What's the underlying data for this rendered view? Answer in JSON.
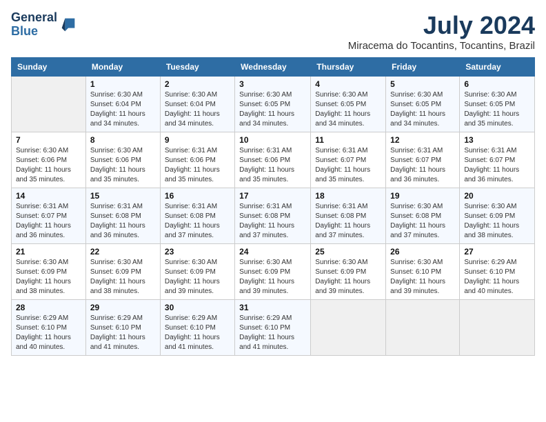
{
  "header": {
    "logo_line1": "General",
    "logo_line2": "Blue",
    "main_title": "July 2024",
    "subtitle": "Miracema do Tocantins, Tocantins, Brazil"
  },
  "calendar": {
    "days_of_week": [
      "Sunday",
      "Monday",
      "Tuesday",
      "Wednesday",
      "Thursday",
      "Friday",
      "Saturday"
    ],
    "weeks": [
      [
        {
          "day": "",
          "info": ""
        },
        {
          "day": "1",
          "info": "Sunrise: 6:30 AM\nSunset: 6:04 PM\nDaylight: 11 hours\nand 34 minutes."
        },
        {
          "day": "2",
          "info": "Sunrise: 6:30 AM\nSunset: 6:04 PM\nDaylight: 11 hours\nand 34 minutes."
        },
        {
          "day": "3",
          "info": "Sunrise: 6:30 AM\nSunset: 6:05 PM\nDaylight: 11 hours\nand 34 minutes."
        },
        {
          "day": "4",
          "info": "Sunrise: 6:30 AM\nSunset: 6:05 PM\nDaylight: 11 hours\nand 34 minutes."
        },
        {
          "day": "5",
          "info": "Sunrise: 6:30 AM\nSunset: 6:05 PM\nDaylight: 11 hours\nand 34 minutes."
        },
        {
          "day": "6",
          "info": "Sunrise: 6:30 AM\nSunset: 6:05 PM\nDaylight: 11 hours\nand 35 minutes."
        }
      ],
      [
        {
          "day": "7",
          "info": "Sunrise: 6:30 AM\nSunset: 6:06 PM\nDaylight: 11 hours\nand 35 minutes."
        },
        {
          "day": "8",
          "info": "Sunrise: 6:30 AM\nSunset: 6:06 PM\nDaylight: 11 hours\nand 35 minutes."
        },
        {
          "day": "9",
          "info": "Sunrise: 6:31 AM\nSunset: 6:06 PM\nDaylight: 11 hours\nand 35 minutes."
        },
        {
          "day": "10",
          "info": "Sunrise: 6:31 AM\nSunset: 6:06 PM\nDaylight: 11 hours\nand 35 minutes."
        },
        {
          "day": "11",
          "info": "Sunrise: 6:31 AM\nSunset: 6:07 PM\nDaylight: 11 hours\nand 35 minutes."
        },
        {
          "day": "12",
          "info": "Sunrise: 6:31 AM\nSunset: 6:07 PM\nDaylight: 11 hours\nand 36 minutes."
        },
        {
          "day": "13",
          "info": "Sunrise: 6:31 AM\nSunset: 6:07 PM\nDaylight: 11 hours\nand 36 minutes."
        }
      ],
      [
        {
          "day": "14",
          "info": "Sunrise: 6:31 AM\nSunset: 6:07 PM\nDaylight: 11 hours\nand 36 minutes."
        },
        {
          "day": "15",
          "info": "Sunrise: 6:31 AM\nSunset: 6:08 PM\nDaylight: 11 hours\nand 36 minutes."
        },
        {
          "day": "16",
          "info": "Sunrise: 6:31 AM\nSunset: 6:08 PM\nDaylight: 11 hours\nand 37 minutes."
        },
        {
          "day": "17",
          "info": "Sunrise: 6:31 AM\nSunset: 6:08 PM\nDaylight: 11 hours\nand 37 minutes."
        },
        {
          "day": "18",
          "info": "Sunrise: 6:31 AM\nSunset: 6:08 PM\nDaylight: 11 hours\nand 37 minutes."
        },
        {
          "day": "19",
          "info": "Sunrise: 6:30 AM\nSunset: 6:08 PM\nDaylight: 11 hours\nand 37 minutes."
        },
        {
          "day": "20",
          "info": "Sunrise: 6:30 AM\nSunset: 6:09 PM\nDaylight: 11 hours\nand 38 minutes."
        }
      ],
      [
        {
          "day": "21",
          "info": "Sunrise: 6:30 AM\nSunset: 6:09 PM\nDaylight: 11 hours\nand 38 minutes."
        },
        {
          "day": "22",
          "info": "Sunrise: 6:30 AM\nSunset: 6:09 PM\nDaylight: 11 hours\nand 38 minutes."
        },
        {
          "day": "23",
          "info": "Sunrise: 6:30 AM\nSunset: 6:09 PM\nDaylight: 11 hours\nand 39 minutes."
        },
        {
          "day": "24",
          "info": "Sunrise: 6:30 AM\nSunset: 6:09 PM\nDaylight: 11 hours\nand 39 minutes."
        },
        {
          "day": "25",
          "info": "Sunrise: 6:30 AM\nSunset: 6:09 PM\nDaylight: 11 hours\nand 39 minutes."
        },
        {
          "day": "26",
          "info": "Sunrise: 6:30 AM\nSunset: 6:10 PM\nDaylight: 11 hours\nand 39 minutes."
        },
        {
          "day": "27",
          "info": "Sunrise: 6:29 AM\nSunset: 6:10 PM\nDaylight: 11 hours\nand 40 minutes."
        }
      ],
      [
        {
          "day": "28",
          "info": "Sunrise: 6:29 AM\nSunset: 6:10 PM\nDaylight: 11 hours\nand 40 minutes."
        },
        {
          "day": "29",
          "info": "Sunrise: 6:29 AM\nSunset: 6:10 PM\nDaylight: 11 hours\nand 41 minutes."
        },
        {
          "day": "30",
          "info": "Sunrise: 6:29 AM\nSunset: 6:10 PM\nDaylight: 11 hours\nand 41 minutes."
        },
        {
          "day": "31",
          "info": "Sunrise: 6:29 AM\nSunset: 6:10 PM\nDaylight: 11 hours\nand 41 minutes."
        },
        {
          "day": "",
          "info": ""
        },
        {
          "day": "",
          "info": ""
        },
        {
          "day": "",
          "info": ""
        }
      ]
    ]
  }
}
